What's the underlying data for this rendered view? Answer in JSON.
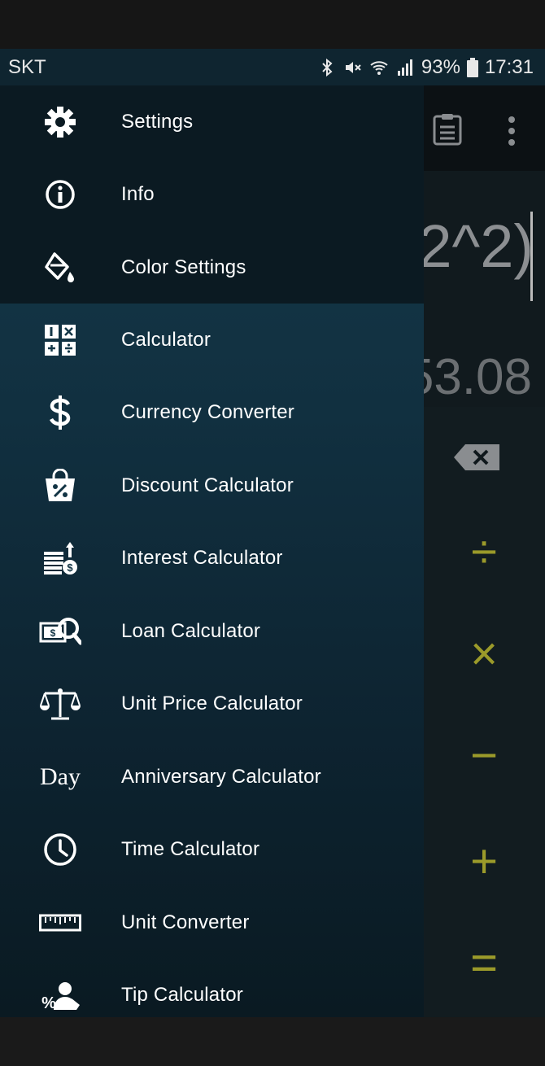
{
  "status_bar": {
    "carrier": "SKT",
    "battery": "93%",
    "time": "17:31"
  },
  "calculator": {
    "expression": "2^2)",
    "result": "53.08",
    "keys": [
      "÷",
      "×",
      "−",
      "+",
      "="
    ]
  },
  "drawer": {
    "top_items": [
      {
        "label": "Settings",
        "icon": "gear-icon"
      },
      {
        "label": "Info",
        "icon": "info-icon"
      },
      {
        "label": "Color Settings",
        "icon": "paint-bucket-icon"
      }
    ],
    "items": [
      {
        "label": "Calculator",
        "icon": "calculator-icon"
      },
      {
        "label": "Currency Converter",
        "icon": "dollar-icon"
      },
      {
        "label": "Discount Calculator",
        "icon": "percent-bag-icon"
      },
      {
        "label": "Interest Calculator",
        "icon": "interest-icon"
      },
      {
        "label": "Loan Calculator",
        "icon": "loan-search-icon"
      },
      {
        "label": "Unit Price Calculator",
        "icon": "scale-icon"
      },
      {
        "label": "Anniversary Calculator",
        "icon": "day-icon",
        "icon_text": "Day"
      },
      {
        "label": "Time Calculator",
        "icon": "clock-icon"
      },
      {
        "label": "Unit Converter",
        "icon": "ruler-icon"
      },
      {
        "label": "Tip Calculator",
        "icon": "tip-icon"
      }
    ]
  },
  "colors": {
    "accent": "#9b9a2a",
    "drawer_top": "#0b1a22",
    "drawer_gradient_start": "#15394a"
  }
}
